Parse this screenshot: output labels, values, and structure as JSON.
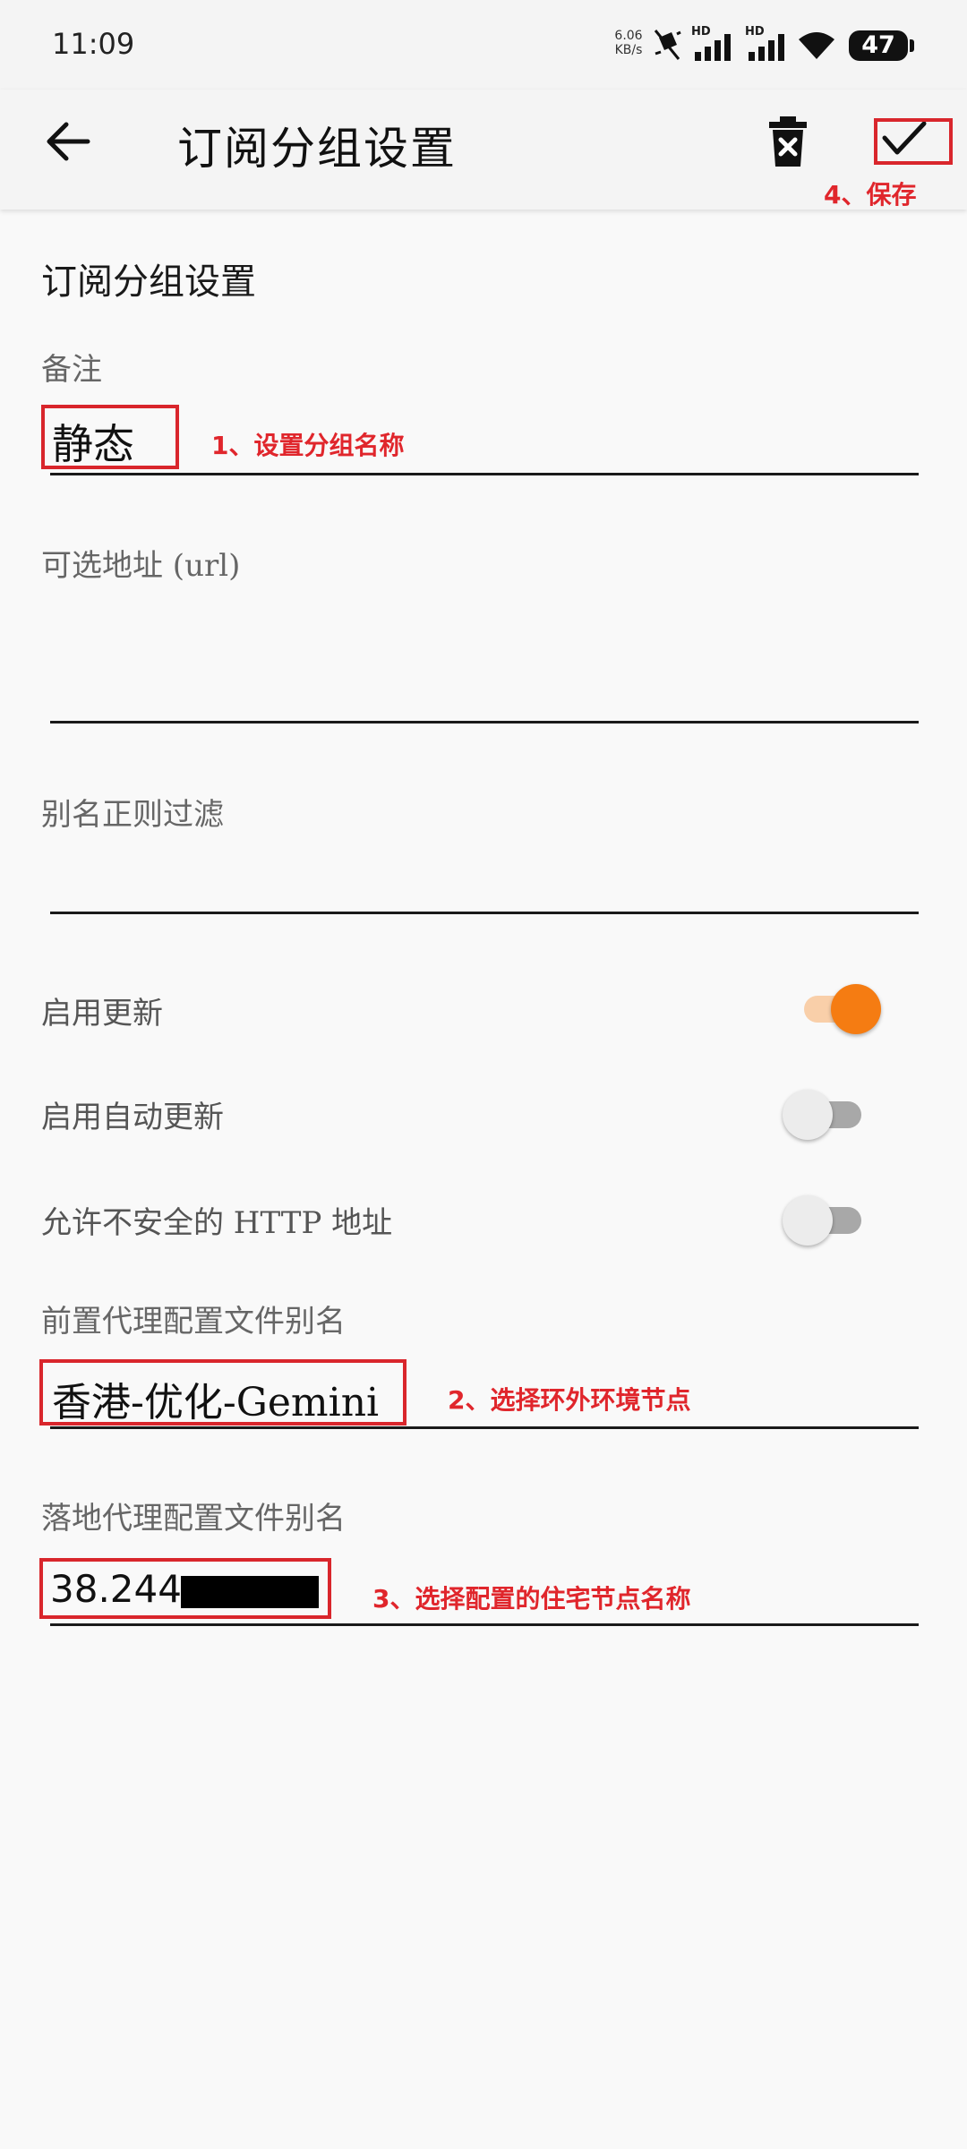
{
  "status_bar": {
    "time": "11:09",
    "net_speed_value": "6.06",
    "net_speed_unit": "KB/s",
    "signal_1_label": "HD",
    "signal_2_label": "HD",
    "battery": "47"
  },
  "app_bar": {
    "title": "订阅分组设置",
    "back_icon": "arrow-left-icon",
    "delete_icon": "delete-icon",
    "save_icon": "check-icon"
  },
  "form": {
    "section_title": "订阅分组设置",
    "remark": {
      "label": "备注",
      "value": "静态"
    },
    "url": {
      "label": "可选地址 (url)",
      "value": ""
    },
    "alias_filter": {
      "label": "别名正则过滤",
      "value": ""
    },
    "switches": [
      {
        "label": "启用更新",
        "on": true
      },
      {
        "label": "启用自动更新",
        "on": false
      },
      {
        "label": "允许不安全的 HTTP 地址",
        "on": false
      }
    ],
    "front_proxy": {
      "label": "前置代理配置文件别名",
      "value": "香港-优化-Gemini"
    },
    "landing_proxy": {
      "label": "落地代理配置文件别名",
      "value": "38.244."
    }
  },
  "annotations": {
    "step1": "1、设置分组名称",
    "step2": "2、选择环外环境节点",
    "step3": "3、选择配置的住宅节点名称",
    "step4": "4、保存"
  },
  "colors": {
    "accent": "#f57c12",
    "accent_track": "#f9cfa9",
    "annotation_red": "#d9262c",
    "switch_off_thumb": "#ececec",
    "switch_off_track": "#a8a8a8"
  }
}
